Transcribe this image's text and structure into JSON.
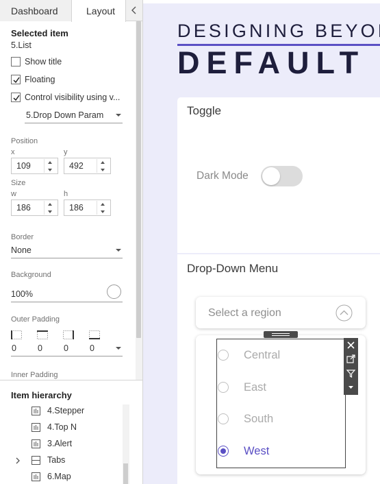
{
  "sidepanel": {
    "tabs": {
      "dashboard": "Dashboard",
      "layout": "Layout"
    },
    "selected_item_heading": "Selected item",
    "selected_item_name": "5.List",
    "show_title": {
      "label": "Show title",
      "checked": false
    },
    "floating": {
      "label": "Floating",
      "checked": true
    },
    "control_visibility": {
      "label": "Control visibility using v...",
      "checked": true
    },
    "visibility_param": "5.Drop Down Param",
    "position": {
      "label": "Position",
      "x_label": "x",
      "x": "109",
      "y_label": "y",
      "y": "492"
    },
    "size": {
      "label": "Size",
      "w_label": "w",
      "w": "186",
      "h_label": "h",
      "h": "186"
    },
    "border": {
      "label": "Border",
      "value": "None"
    },
    "background": {
      "label": "Background",
      "value": "100%"
    },
    "outer_padding": {
      "label": "Outer Padding",
      "values": [
        "0",
        "0",
        "0",
        "0"
      ]
    },
    "inner_padding_label": "Inner Padding",
    "hierarchy": {
      "title": "Item hierarchy",
      "items": [
        {
          "name": "4.Stepper",
          "icon": "sheet-icon"
        },
        {
          "name": "4.Top N",
          "icon": "sheet-icon"
        },
        {
          "name": "3.Alert",
          "icon": "sheet-icon"
        },
        {
          "name": "Tabs",
          "icon": "container-icon",
          "expandable": true
        },
        {
          "name": "6.Map",
          "icon": "sheet-icon"
        }
      ]
    }
  },
  "canvas": {
    "header_line1": "DESIGNING BEYOND",
    "header_line2": "DEFAULT",
    "accent_color": "#5a4fc4",
    "toggle_card": {
      "title": "Toggle",
      "dark_mode_label": "Dark Mode",
      "dark_mode_on": false
    },
    "dropdown_card": {
      "title": "Drop-Down Menu",
      "placeholder": "Select a region",
      "options": [
        {
          "label": "Central",
          "selected": false
        },
        {
          "label": "East",
          "selected": false
        },
        {
          "label": "South",
          "selected": false
        },
        {
          "label": "West",
          "selected": true
        }
      ]
    }
  }
}
